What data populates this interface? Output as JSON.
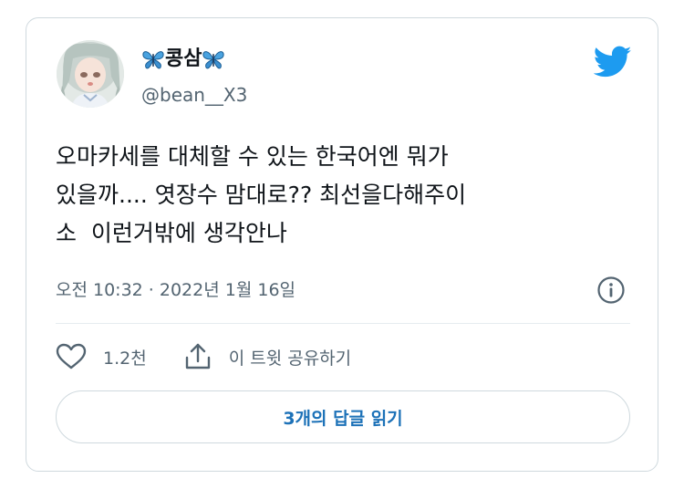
{
  "tweet": {
    "display_name": "콩삼",
    "handle": "@bean__X3",
    "text": "오마카세를 대체할 수 있는 한국어엔 뭐가\n있을까.... 엿장수 맘대로?? 최선을다해주이\n소  이런거밖에 생각안나",
    "timestamp": "오전 10:32 · 2022년 1월 16일",
    "likes": "1.2천",
    "share_label": "이 트윗 공유하기",
    "replies_button": "3개의 답글 읽기"
  },
  "icons": {
    "name_decoration": "butterfly-emoji",
    "brand": "twitter-bird-icon",
    "info": "info-icon",
    "like": "heart-icon",
    "share": "share-icon"
  },
  "colors": {
    "brand_blue": "#1d9bf0",
    "secondary_text": "#536471",
    "primary_text": "#0f1419",
    "link_text": "#1d72b8",
    "border": "#cfd9de"
  }
}
